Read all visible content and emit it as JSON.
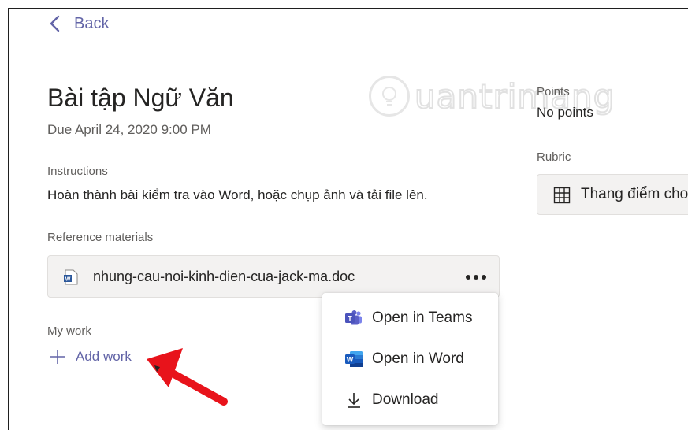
{
  "nav": {
    "back_label": "Back"
  },
  "assignment": {
    "title": "Bài tập Ngữ Văn",
    "due": "Due April 24, 2020 9:00 PM",
    "instructions_heading": "Instructions",
    "instructions_text": "Hoàn thành bài kiểm tra vào Word, hoặc chụp ảnh và tải file lên.",
    "reference_heading": "Reference materials",
    "reference_file": {
      "name": "nhung-cau-noi-kinh-dien-cua-jack-ma.doc",
      "icon": "word-doc-icon"
    },
    "my_work_heading": "My work",
    "add_work_label": "Add work"
  },
  "sidebar": {
    "points_heading": "Points",
    "points_value": "No points",
    "rubric_heading": "Rubric",
    "rubric_button": "Thang điểm cho"
  },
  "context_menu": {
    "items": [
      {
        "label": "Open in Teams",
        "icon": "teams-icon"
      },
      {
        "label": "Open in Word",
        "icon": "word-icon"
      },
      {
        "label": "Download",
        "icon": "download-icon"
      }
    ]
  },
  "watermark": {
    "text": "uantrimang"
  },
  "colors": {
    "accent": "#6264a7",
    "arrow": "#e8131b",
    "word_blue": "#2b579a",
    "teams_purple": "#5b5fc7"
  }
}
